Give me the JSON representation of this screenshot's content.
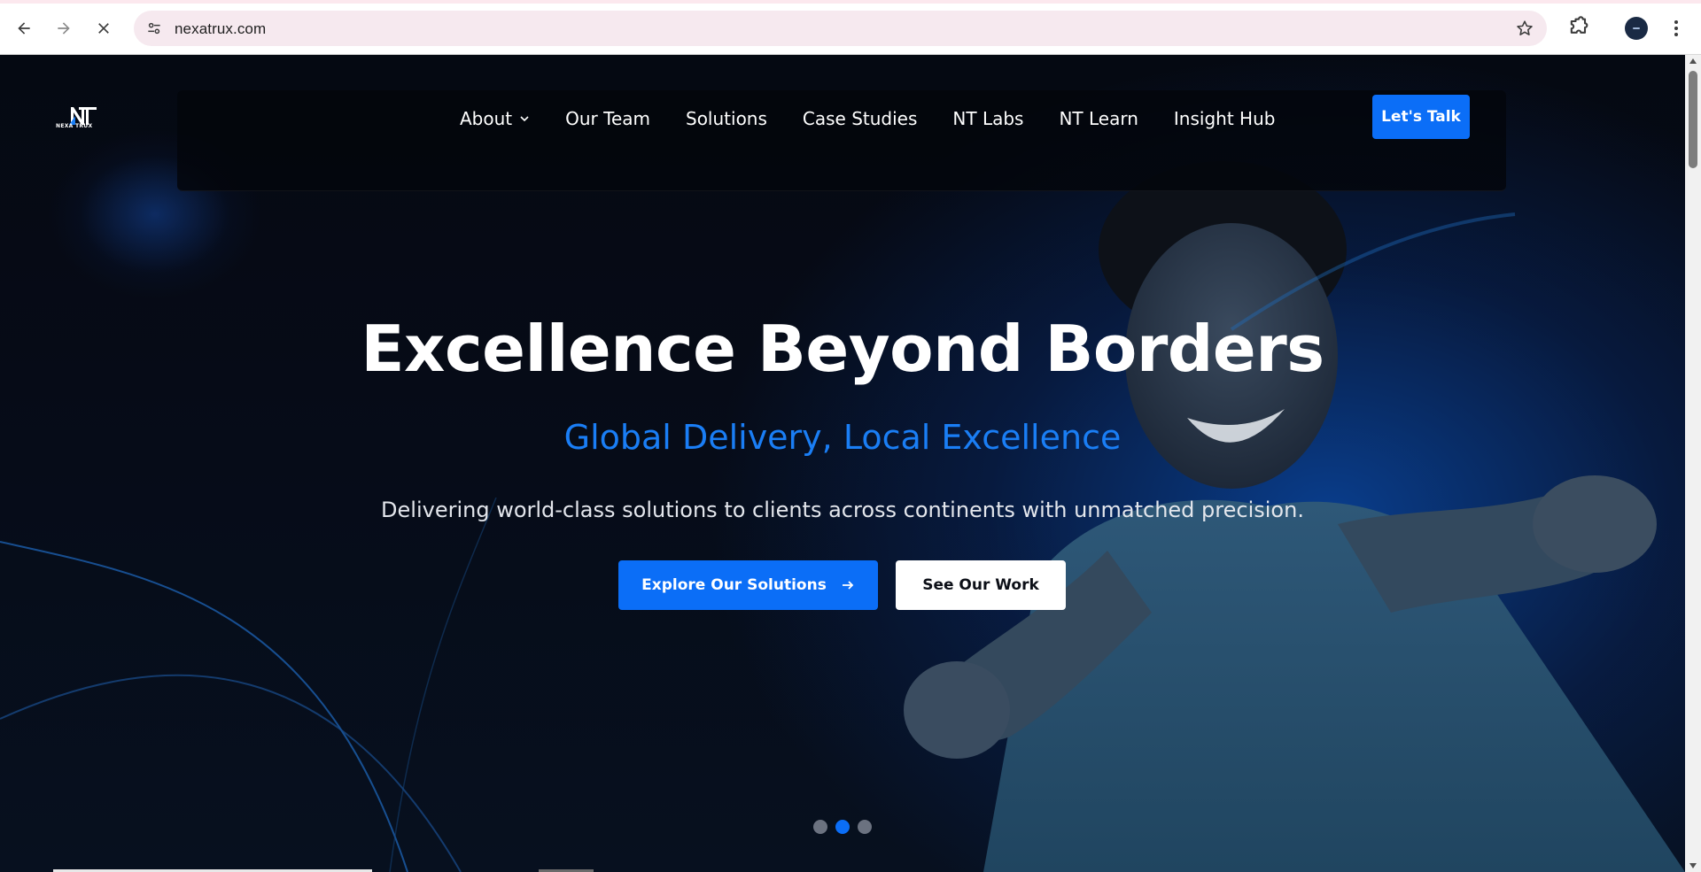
{
  "browser": {
    "url": "nexatrux.com",
    "back_icon": "arrow-left-icon",
    "forward_icon": "arrow-right-icon",
    "stop_icon": "close-icon",
    "site_info_icon": "tune-icon",
    "bookmark_icon": "star-icon",
    "extensions_icon": "puzzle-icon",
    "menu_icon": "more-vert-icon"
  },
  "header": {
    "logo_text": "NEXA TRUX",
    "nav": [
      {
        "label": "About",
        "has_dropdown": true
      },
      {
        "label": "Our Team"
      },
      {
        "label": "Solutions"
      },
      {
        "label": "Case Studies"
      },
      {
        "label": "NT Labs"
      },
      {
        "label": "NT Learn"
      },
      {
        "label": "Insight Hub"
      }
    ],
    "cta_label": "Let's Talk"
  },
  "hero": {
    "title": "Excellence Beyond Borders",
    "subtitle": "Global Delivery, Local Excellence",
    "description": "Delivering world-class solutions to clients across continents with unmatched precision.",
    "primary_button": "Explore Our Solutions",
    "secondary_button": "See Our Work",
    "slides_total": 3,
    "active_slide": 2
  },
  "colors": {
    "accent": "#0b6ef7",
    "subtitle": "#1a7ef5",
    "background": "#05080f"
  }
}
